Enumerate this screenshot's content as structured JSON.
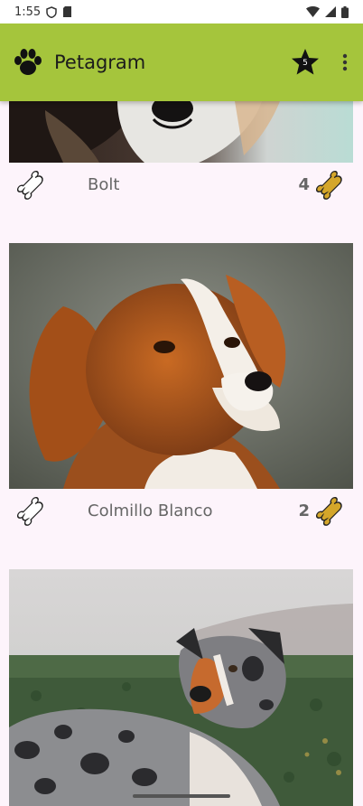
{
  "status_bar": {
    "time": "1:55",
    "icons": [
      "shield-icon",
      "sd-card-icon",
      "wifi-icon",
      "signal-icon",
      "battery-icon"
    ]
  },
  "app_bar": {
    "title": "Petagram",
    "logo_icon": "paw-icon",
    "favorites_count": "5",
    "favorites_icon": "star-icon",
    "menu_icon": "more-vert-icon",
    "color": "#a5c53c"
  },
  "pets": [
    {
      "name": "Bolt",
      "rating": "4"
    },
    {
      "name": "Colmillo Blanco",
      "rating": "2"
    }
  ],
  "icons": {
    "like": "bone-outline-icon",
    "rating": "bone-filled-icon"
  },
  "colors": {
    "background": "#fdf4fb",
    "bone_filled": "#d4a62a"
  }
}
